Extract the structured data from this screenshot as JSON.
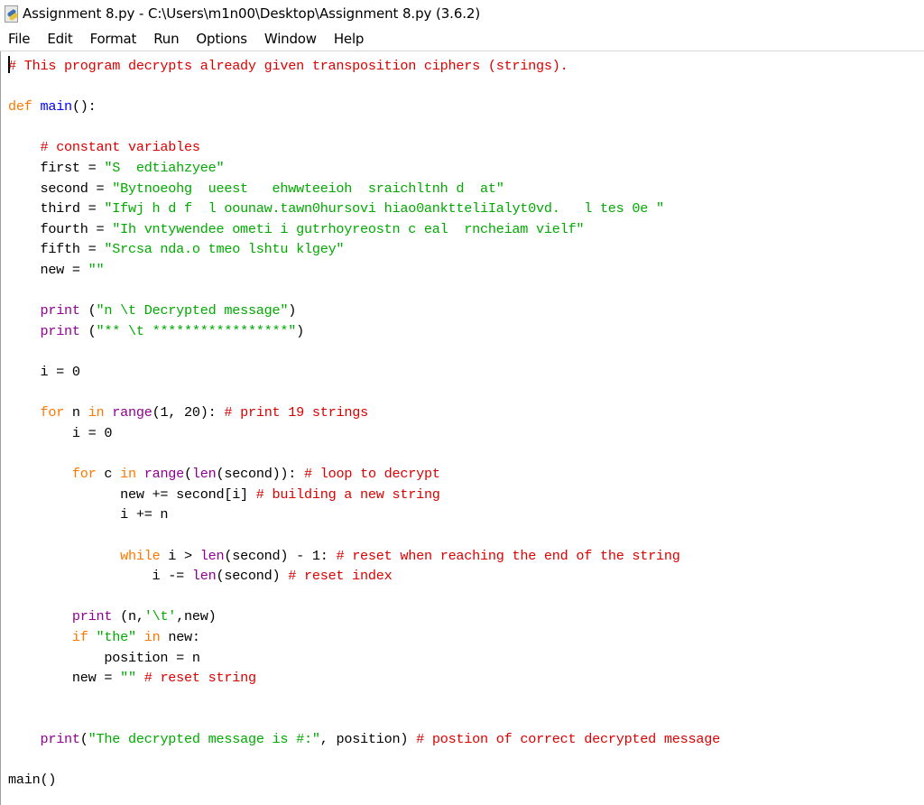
{
  "window": {
    "title": "Assignment 8.py - C:\\Users\\m1n00\\Desktop\\Assignment 8.py (3.6.2)",
    "icon": "python-idle-icon"
  },
  "menubar": {
    "items": [
      "File",
      "Edit",
      "Format",
      "Run",
      "Options",
      "Window",
      "Help"
    ]
  },
  "editor": {
    "colors": {
      "keyword": "#ff7700",
      "builtin": "#900090",
      "string": "#00aa00",
      "comment": "#dd0000",
      "definition": "#0000ff",
      "text": "#000000"
    },
    "lines": [
      [
        [
          "cmt",
          "# This program decrypts already given transposition ciphers (strings)."
        ]
      ],
      [],
      [
        [
          "kw",
          "def"
        ],
        [
          "txt",
          " "
        ],
        [
          "def",
          "main"
        ],
        [
          "txt",
          "():"
        ]
      ],
      [],
      [
        [
          "txt",
          "    "
        ],
        [
          "cmt",
          "# constant variables"
        ]
      ],
      [
        [
          "txt",
          "    first = "
        ],
        [
          "str",
          "\"S  edtiahzyee\""
        ]
      ],
      [
        [
          "txt",
          "    second = "
        ],
        [
          "str",
          "\"Bytnoeohg  ueest   ehwwteeioh  sraichltnh d  at\""
        ]
      ],
      [
        [
          "txt",
          "    third = "
        ],
        [
          "str",
          "\"Ifwj h d f  l oounaw.tawn0hursovi hiao0anktteliIalyt0vd.   l tes 0e \""
        ]
      ],
      [
        [
          "txt",
          "    fourth = "
        ],
        [
          "str",
          "\"Ih vntywendee ometi i gutrhoyreostn c eal  rncheiam vielf\""
        ]
      ],
      [
        [
          "txt",
          "    fifth = "
        ],
        [
          "str",
          "\"Srcsa nda.o tmeo lshtu klgey\""
        ]
      ],
      [
        [
          "txt",
          "    new = "
        ],
        [
          "str",
          "\"\""
        ]
      ],
      [],
      [
        [
          "txt",
          "    "
        ],
        [
          "bi",
          "print"
        ],
        [
          "txt",
          " ("
        ],
        [
          "str",
          "\"n \\t Decrypted message\""
        ],
        [
          "txt",
          ")"
        ]
      ],
      [
        [
          "txt",
          "    "
        ],
        [
          "bi",
          "print"
        ],
        [
          "txt",
          " ("
        ],
        [
          "str",
          "\"** \\t *****************\""
        ],
        [
          "txt",
          ")"
        ]
      ],
      [],
      [
        [
          "txt",
          "    i = 0"
        ]
      ],
      [],
      [
        [
          "txt",
          "    "
        ],
        [
          "kw",
          "for"
        ],
        [
          "txt",
          " n "
        ],
        [
          "kw",
          "in"
        ],
        [
          "txt",
          " "
        ],
        [
          "bi",
          "range"
        ],
        [
          "txt",
          "(1, 20): "
        ],
        [
          "cmt",
          "# print 19 strings"
        ]
      ],
      [
        [
          "txt",
          "        i = 0"
        ]
      ],
      [],
      [
        [
          "txt",
          "        "
        ],
        [
          "kw",
          "for"
        ],
        [
          "txt",
          " c "
        ],
        [
          "kw",
          "in"
        ],
        [
          "txt",
          " "
        ],
        [
          "bi",
          "range"
        ],
        [
          "txt",
          "("
        ],
        [
          "bi",
          "len"
        ],
        [
          "txt",
          "(second)): "
        ],
        [
          "cmt",
          "# loop to decrypt"
        ]
      ],
      [
        [
          "txt",
          "              new += second[i] "
        ],
        [
          "cmt",
          "# building a new string"
        ]
      ],
      [
        [
          "txt",
          "              i += n"
        ]
      ],
      [],
      [
        [
          "txt",
          "              "
        ],
        [
          "kw",
          "while"
        ],
        [
          "txt",
          " i > "
        ],
        [
          "bi",
          "len"
        ],
        [
          "txt",
          "(second) - 1: "
        ],
        [
          "cmt",
          "# reset when reaching the end of the string"
        ]
      ],
      [
        [
          "txt",
          "                  i -= "
        ],
        [
          "bi",
          "len"
        ],
        [
          "txt",
          "(second) "
        ],
        [
          "cmt",
          "# reset index"
        ]
      ],
      [],
      [
        [
          "txt",
          "        "
        ],
        [
          "bi",
          "print"
        ],
        [
          "txt",
          " (n,"
        ],
        [
          "str",
          "'\\t'"
        ],
        [
          "txt",
          ",new)"
        ]
      ],
      [
        [
          "txt",
          "        "
        ],
        [
          "kw",
          "if"
        ],
        [
          "txt",
          " "
        ],
        [
          "str",
          "\"the\""
        ],
        [
          "txt",
          " "
        ],
        [
          "kw",
          "in"
        ],
        [
          "txt",
          " new:"
        ]
      ],
      [
        [
          "txt",
          "            position = n"
        ]
      ],
      [
        [
          "txt",
          "        new = "
        ],
        [
          "str",
          "\"\""
        ],
        [
          "txt",
          " "
        ],
        [
          "cmt",
          "# reset string"
        ]
      ],
      [],
      [],
      [
        [
          "txt",
          "    "
        ],
        [
          "bi",
          "print"
        ],
        [
          "txt",
          "("
        ],
        [
          "str",
          "\"The decrypted message is #:\""
        ],
        [
          "txt",
          ", position) "
        ],
        [
          "cmt",
          "# postion of correct decrypted message"
        ]
      ],
      [],
      [
        [
          "txt",
          "main()"
        ]
      ]
    ]
  }
}
